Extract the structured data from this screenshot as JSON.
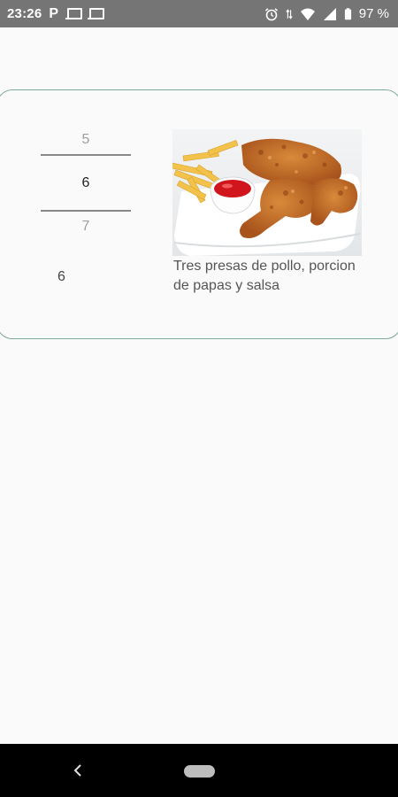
{
  "status_bar": {
    "time": "23:26",
    "app_letter": "P",
    "battery_percent": "97 %",
    "icons": [
      "p-icon",
      "laptop-icon",
      "laptop-icon",
      "alarm-icon",
      "data-arrows-icon",
      "wifi-icon",
      "signal-icon",
      "battery-icon"
    ]
  },
  "picker": {
    "prev": "5",
    "selected": "6",
    "next": "7"
  },
  "quantity_value": "6",
  "product": {
    "image_name": "fried-chicken-fries-ketchup",
    "description": "Tres presas de pollo, porcion de papas y salsa"
  },
  "colors": {
    "status_bar": "#757575",
    "card_border": "#7fa99a",
    "background": "#fafafa",
    "nav_bar": "#000000"
  }
}
